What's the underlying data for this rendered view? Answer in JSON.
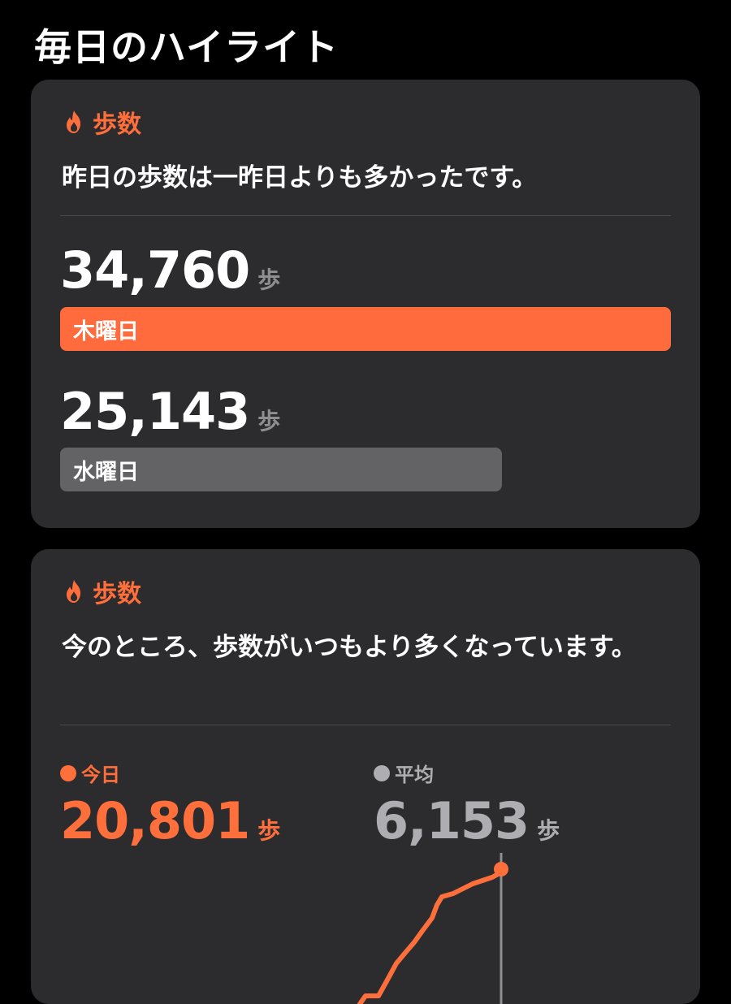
{
  "page": {
    "title": "毎日のハイライト"
  },
  "cards": [
    {
      "category": "歩数",
      "message": "昨日の歩数は一昨日よりも多かったです。",
      "current": {
        "value": "34,760",
        "unit": "歩",
        "day": "木曜日",
        "bar_fraction": 1.0
      },
      "previous": {
        "value": "25,143",
        "unit": "歩",
        "day": "水曜日",
        "bar_fraction": 0.723
      }
    },
    {
      "category": "歩数",
      "message": "今のところ、歩数がいつもより多くなっています。",
      "today": {
        "label": "今日",
        "value": "20,801",
        "unit": "歩"
      },
      "average": {
        "label": "平均",
        "value": "6,153",
        "unit": "歩"
      }
    }
  ],
  "colors": {
    "accent": "#ff6b3d",
    "secondary_bar": "#636366",
    "average": "#aeaeb2",
    "card_bg": "#2c2c2e"
  },
  "icons": {
    "category_icon": "flame-icon"
  }
}
